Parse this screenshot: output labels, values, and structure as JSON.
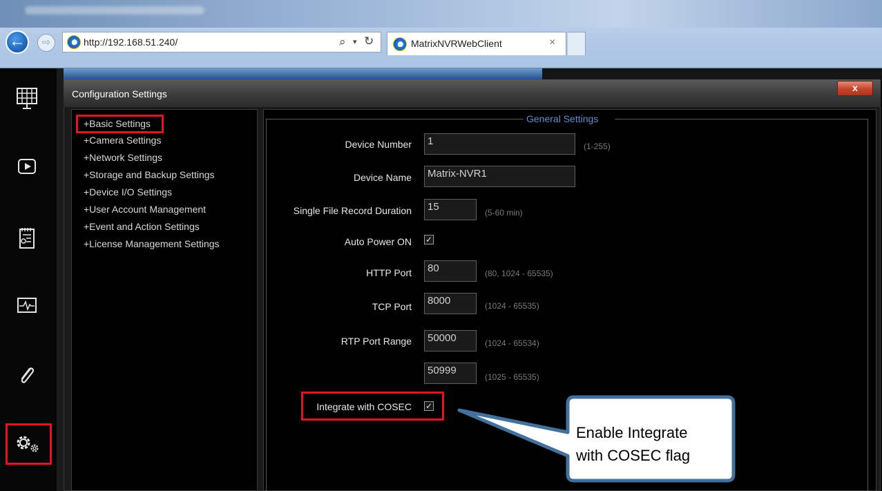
{
  "browser": {
    "url": "http://192.168.51.240/",
    "url_host": "192.168.51.240",
    "tab_title": "MatrixNVRWebClient",
    "tab_close": "×",
    "back_glyph": "←",
    "forward_glyph": "⇨",
    "search_glyph": "⌕",
    "dropdown_glyph": "▾",
    "refresh_glyph": "↻",
    "ie_glyph": "e"
  },
  "sidebar": {
    "items": [
      {
        "name": "live-view",
        "icon": "grid-monitor-icon"
      },
      {
        "name": "playback",
        "icon": "play-icon"
      },
      {
        "name": "event-logs",
        "icon": "log-icon"
      },
      {
        "name": "system-monitor",
        "icon": "pulse-icon"
      },
      {
        "name": "attachments",
        "icon": "paperclip-icon"
      },
      {
        "name": "settings",
        "icon": "gears-icon",
        "selected": true
      }
    ]
  },
  "dialog": {
    "title": "Configuration Settings",
    "close_label": "x",
    "tree": [
      "+Basic Settings",
      "+Camera Settings",
      "+Network Settings",
      "+Storage and Backup Settings",
      "+Device I/O Settings",
      "+User Account Management",
      "+Event and Action Settings",
      "+License Management Settings"
    ],
    "group_title": "General Settings",
    "fields": {
      "device_number": {
        "label": "Device Number",
        "value": "1",
        "hint": "(1-255)"
      },
      "device_name": {
        "label": "Device Name",
        "value": "Matrix-NVR1"
      },
      "record_duration": {
        "label": "Single File Record Duration",
        "value": "15",
        "hint": "(5-60 min)"
      },
      "auto_power_on": {
        "label": "Auto Power ON",
        "checked": true
      },
      "http_port": {
        "label": "HTTP Port",
        "value": "80",
        "hint": "(80, 1024 - 65535)"
      },
      "tcp_port": {
        "label": "TCP Port",
        "value": "8000",
        "hint": "(1024 - 65535)"
      },
      "rtp_range": {
        "label": "RTP Port Range",
        "start": "50000",
        "start_hint": "(1024 - 65534)",
        "end": "50999",
        "end_hint": "(1025 - 65535)"
      },
      "integrate_cosec": {
        "label": "Integrate with COSEC",
        "checked": true
      }
    }
  },
  "callout": {
    "line1": "Enable Integrate",
    "line2": "with COSEC flag"
  },
  "colors": {
    "highlight": "#e3141b",
    "group_title": "#5d8fd1",
    "callout_border": "#41719c"
  }
}
